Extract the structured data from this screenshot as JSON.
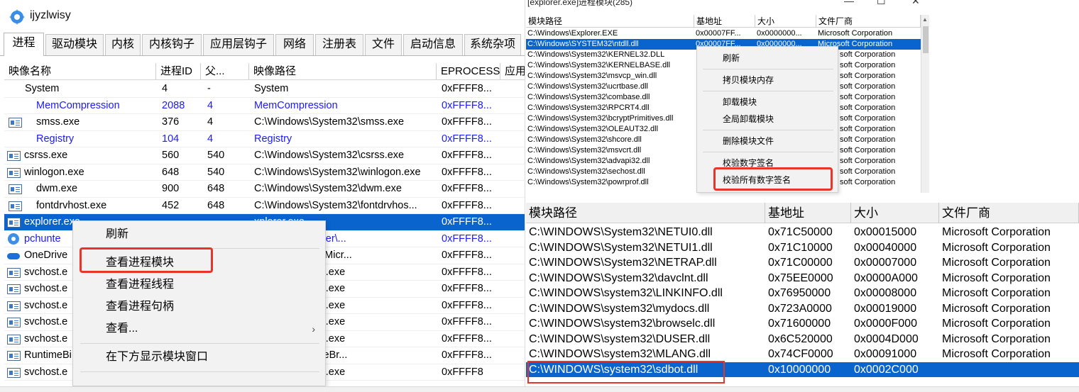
{
  "left": {
    "title": "ijyzlwisy",
    "tabs": [
      "进程",
      "驱动模块",
      "内核",
      "内核钩子",
      "应用层钩子",
      "网络",
      "注册表",
      "文件",
      "启动信息",
      "系统杂项"
    ],
    "columns": [
      "映像名称",
      "进程ID",
      "父...",
      "映像路径",
      "EPROCESS",
      "应用"
    ],
    "rows": [
      {
        "icon": "none",
        "name": "System",
        "pid": "4",
        "ppid": "-",
        "path": "System",
        "eprocess": "0xFFFF8..."
      },
      {
        "icon": "none",
        "name": "MemCompression",
        "pid": "2088",
        "ppid": "4",
        "path": "MemCompression",
        "eprocess": "0xFFFF8..."
      },
      {
        "icon": "window",
        "name": "smss.exe",
        "pid": "376",
        "ppid": "4",
        "path": "C:\\Windows\\System32\\smss.exe",
        "eprocess": "0xFFFF8..."
      },
      {
        "icon": "none",
        "name": "Registry",
        "pid": "104",
        "ppid": "4",
        "path": "Registry",
        "eprocess": "0xFFFF8..."
      },
      {
        "icon": "window",
        "name": "csrss.exe",
        "pid": "560",
        "ppid": "540",
        "path": "C:\\Windows\\System32\\csrss.exe",
        "eprocess": "0xFFFF8..."
      },
      {
        "icon": "window",
        "name": "winlogon.exe",
        "pid": "648",
        "ppid": "540",
        "path": "C:\\Windows\\System32\\winlogon.exe",
        "eprocess": "0xFFFF8..."
      },
      {
        "icon": "window",
        "name": "dwm.exe",
        "pid": "900",
        "ppid": "648",
        "path": "C:\\Windows\\System32\\dwm.exe",
        "eprocess": "0xFFFF8..."
      },
      {
        "icon": "window",
        "name": "fontdrvhost.exe",
        "pid": "452",
        "ppid": "648",
        "path": "C:\\Windows\\System32\\fontdrvhos...",
        "eprocess": "0xFFFF8..."
      },
      {
        "icon": "window",
        "name": "explorer.exe",
        "pid": "",
        "ppid": "",
        "path": "xplorer.exe",
        "eprocess": "0xFFFF8..."
      },
      {
        "icon": "gear",
        "name": "pchunte",
        "pid": "",
        "ppid": "",
        "path": "Desktop\\pchunter\\...",
        "eprocess": "0xFFFF8..."
      },
      {
        "icon": "cloud",
        "name": "OneDrive",
        "pid": "",
        "ppid": "",
        "path": "AppData\\Local\\Micr...",
        "eprocess": "0xFFFF8..."
      },
      {
        "icon": "window",
        "name": "svchost.e",
        "pid": "",
        "ppid": "",
        "path": "stem32\\svchost.exe",
        "eprocess": "0xFFFF8..."
      },
      {
        "icon": "window",
        "name": "svchost.e",
        "pid": "",
        "ppid": "",
        "path": "stem32\\svchost.exe",
        "eprocess": "0xFFFF8..."
      },
      {
        "icon": "window",
        "name": "svchost.e",
        "pid": "",
        "ppid": "",
        "path": "stem32\\svchost.exe",
        "eprocess": "0xFFFF8..."
      },
      {
        "icon": "window",
        "name": "svchost.e",
        "pid": "",
        "ppid": "",
        "path": "stem32\\svchost.exe",
        "eprocess": "0xFFFF8..."
      },
      {
        "icon": "window",
        "name": "svchost.e",
        "pid": "",
        "ppid": "",
        "path": "stem32\\svchost.exe",
        "eprocess": "0xFFFF8..."
      },
      {
        "icon": "window",
        "name": "RuntimeBi",
        "pid": "",
        "ppid": "",
        "path": "stem32\\RuntimeBr...",
        "eprocess": "0xFFFF8..."
      },
      {
        "icon": "window",
        "name": "svchost.e",
        "pid": "",
        "ppid": "",
        "path": "stem32\\svchost.exe",
        "eprocess": "0xFFFF8"
      }
    ],
    "context_menu": [
      "刷新",
      "查看进程模块",
      "查看进程线程",
      "查看进程句柄",
      "查看...",
      "在下方显示模块窗口"
    ],
    "submenu_arrow": "›"
  },
  "rtop": {
    "title": "[explorer.exe]进程模块(285)",
    "win_min": "—",
    "win_max": "☐",
    "win_close": "✕",
    "columns": [
      "模块路径",
      "基地址",
      "大小",
      "文件厂商"
    ],
    "rows": [
      {
        "path": "C:\\Windows\\Explorer.EXE",
        "base": "0x00007FF...",
        "size": "0x0000000...",
        "vendor": "Microsoft Corporation"
      },
      {
        "path": "C:\\Windows\\SYSTEM32\\ntdll.dll",
        "base": "0x00007FF...",
        "size": "0x0000000...",
        "vendor": "Microsoft Corporation"
      },
      {
        "path": "C:\\Windows\\System32\\KERNEL32.DLL",
        "base": "",
        "size": "",
        "vendor": "soft Corporation"
      },
      {
        "path": "C:\\Windows\\System32\\KERNELBASE.dll",
        "base": "",
        "size": "",
        "vendor": "soft Corporation"
      },
      {
        "path": "C:\\Windows\\System32\\msvcp_win.dll",
        "base": "",
        "size": "",
        "vendor": "soft Corporation"
      },
      {
        "path": "C:\\Windows\\System32\\ucrtbase.dll",
        "base": "",
        "size": "",
        "vendor": "soft Corporation"
      },
      {
        "path": "C:\\Windows\\System32\\combase.dll",
        "base": "",
        "size": "",
        "vendor": "soft Corporation"
      },
      {
        "path": "C:\\Windows\\System32\\RPCRT4.dll",
        "base": "",
        "size": "",
        "vendor": "soft Corporation"
      },
      {
        "path": "C:\\Windows\\System32\\bcryptPrimitives.dll",
        "base": "",
        "size": "",
        "vendor": "soft Corporation"
      },
      {
        "path": "C:\\Windows\\System32\\OLEAUT32.dll",
        "base": "",
        "size": "",
        "vendor": "soft Corporation"
      },
      {
        "path": "C:\\Windows\\System32\\shcore.dll",
        "base": "",
        "size": "",
        "vendor": "soft Corporation"
      },
      {
        "path": "C:\\Windows\\System32\\msvcrt.dll",
        "base": "",
        "size": "",
        "vendor": "soft Corporation"
      },
      {
        "path": "C:\\Windows\\System32\\advapi32.dll",
        "base": "",
        "size": "",
        "vendor": "soft Corporation"
      },
      {
        "path": "C:\\Windows\\System32\\sechost.dll",
        "base": "",
        "size": "",
        "vendor": "soft Corporation"
      },
      {
        "path": "C:\\Windows\\System32\\powrprof.dll",
        "base": "",
        "size": "",
        "vendor": "soft Corporation"
      }
    ],
    "context_menu": [
      "刷新",
      "拷贝模块内存",
      "卸载模块",
      "全局卸载模块",
      "删除模块文件",
      "校验数字签名",
      "校验所有数字签名"
    ]
  },
  "rbot": {
    "columns": [
      "模块路径",
      "基地址",
      "大小",
      "文件厂商"
    ],
    "rows": [
      {
        "path": "C:\\WINDOWS\\System32\\NETUI0.dll",
        "base": "0x71C50000",
        "size": "0x00015000",
        "vendor": "Microsoft Corporation"
      },
      {
        "path": "C:\\WINDOWS\\System32\\NETUI1.dll",
        "base": "0x71C10000",
        "size": "0x00040000",
        "vendor": "Microsoft Corporation"
      },
      {
        "path": "C:\\WINDOWS\\System32\\NETRAP.dll",
        "base": "0x71C00000",
        "size": "0x00007000",
        "vendor": "Microsoft Corporation"
      },
      {
        "path": "C:\\WINDOWS\\System32\\davclnt.dll",
        "base": "0x75EE0000",
        "size": "0x0000A000",
        "vendor": "Microsoft Corporation"
      },
      {
        "path": "C:\\WINDOWS\\system32\\LINKINFO.dll",
        "base": "0x76950000",
        "size": "0x00008000",
        "vendor": "Microsoft Corporation"
      },
      {
        "path": "C:\\WINDOWS\\system32\\mydocs.dll",
        "base": "0x723A0000",
        "size": "0x00019000",
        "vendor": "Microsoft Corporation"
      },
      {
        "path": "C:\\WINDOWS\\system32\\browselc.dll",
        "base": "0x71600000",
        "size": "0x0000F000",
        "vendor": "Microsoft Corporation"
      },
      {
        "path": "C:\\WINDOWS\\system32\\DUSER.dll",
        "base": "0x6C520000",
        "size": "0x0004D000",
        "vendor": "Microsoft Corporation"
      },
      {
        "path": "C:\\WINDOWS\\system32\\MLANG.dll",
        "base": "0x74CF0000",
        "size": "0x00091000",
        "vendor": "Microsoft Corporation"
      },
      {
        "path": "C:\\WINDOWS\\system32\\sdbot.dll",
        "base": "0x10000000",
        "size": "0x0002C000",
        "vendor": ""
      }
    ]
  }
}
